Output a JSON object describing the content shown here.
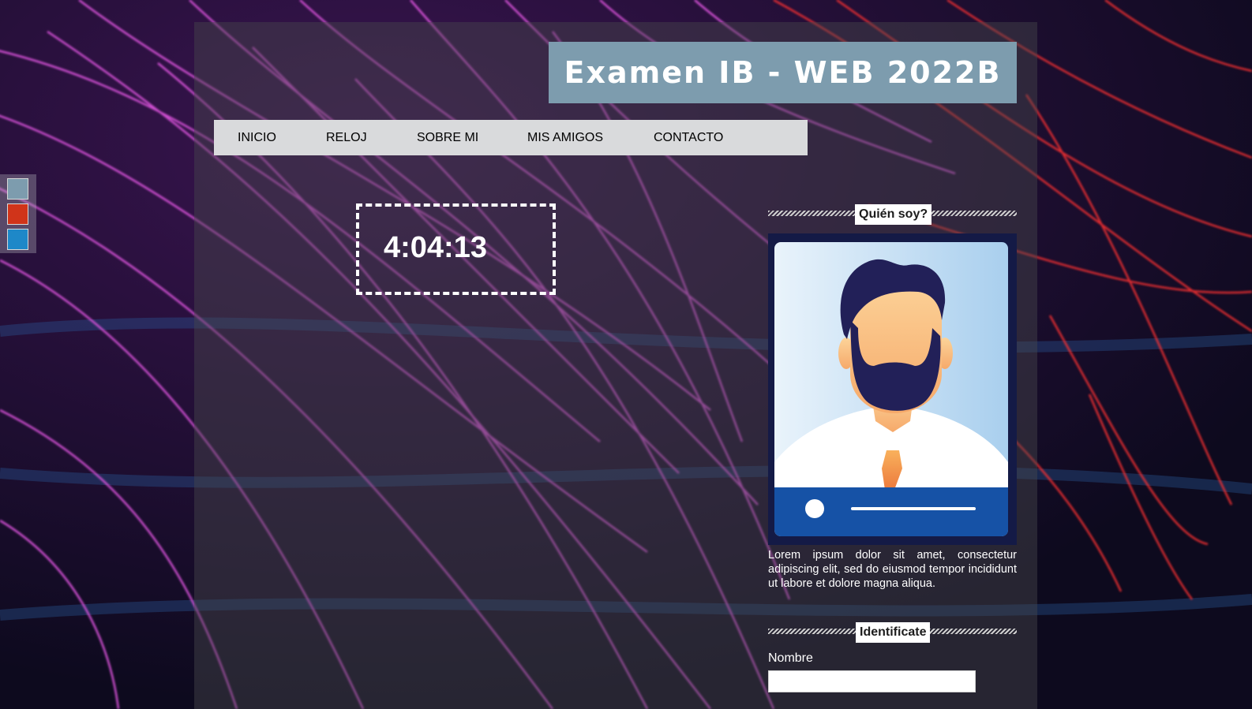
{
  "header": {
    "title": "Examen IB - WEB 2022B"
  },
  "nav": {
    "items": [
      {
        "label": "INICIO"
      },
      {
        "label": "RELOJ"
      },
      {
        "label": "SOBRE MI"
      },
      {
        "label": "MIS AMIGOS"
      },
      {
        "label": "CONTACTO"
      }
    ]
  },
  "theme_swatches": [
    {
      "color": "#7d9cae"
    },
    {
      "color": "#d0341a"
    },
    {
      "color": "#1e88c8"
    }
  ],
  "clock": {
    "time": "4:04:13"
  },
  "sidebar": {
    "about": {
      "heading": "Quién soy?",
      "avatar_icon": "man-profile-card-icon",
      "bio": "Lorem ipsum dolor sit amet, consectetur adipiscing elit, sed do eiusmod tempor incididunt ut labore et dolore magna aliqua."
    },
    "identify": {
      "heading": "Identificate",
      "name_label": "Nombre",
      "name_value": "",
      "name_placeholder": ""
    }
  },
  "colors": {
    "title_bg": "#7d9cae",
    "nav_bg": "#d9dadc",
    "card_bg": "#141a46"
  }
}
